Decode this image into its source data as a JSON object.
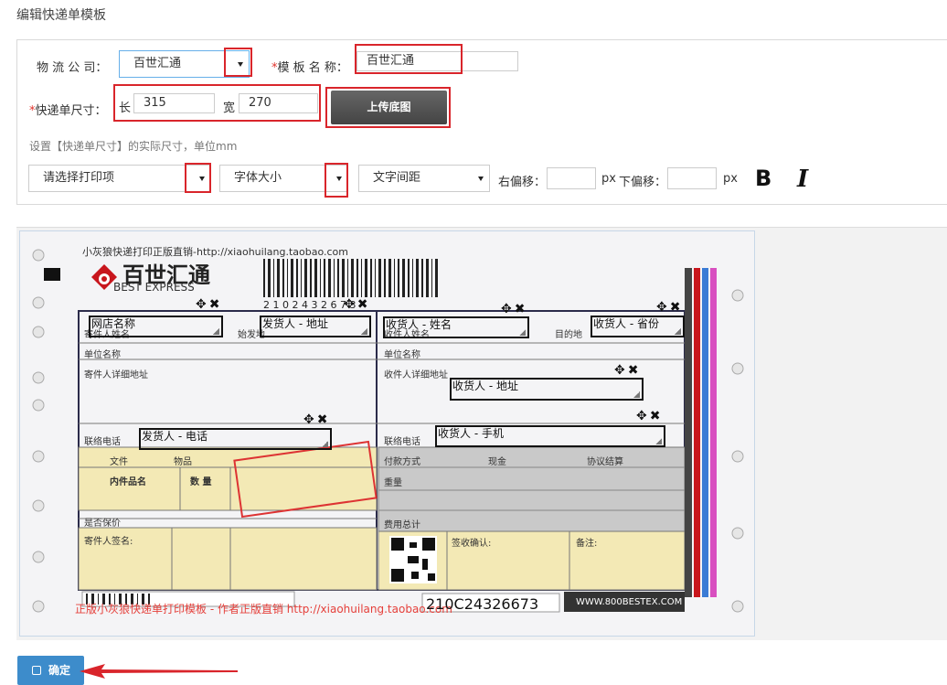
{
  "page_title": "编辑快递单模板",
  "company": {
    "label": "物 流 公 司：",
    "value": "百世汇通"
  },
  "template_name": {
    "required_mark": "*",
    "label": "模 板 名 称：",
    "value": "百世汇通"
  },
  "size": {
    "required_mark": "*",
    "label": "快递单尺寸：",
    "length_label": "长",
    "length_value": "315",
    "width_label": "宽",
    "width_value": "270"
  },
  "upload_button": "上传底图",
  "hint": "设置【快递单尺寸】的实际尺寸，单位mm",
  "print_item_select": "请选择打印项",
  "font_size_select": "字体大小",
  "spacing_select": "文字间距",
  "right_offset_label": "右偏移：",
  "down_offset_label": "下偏移：",
  "px_unit": "px",
  "bold_label": "B",
  "italic_label": "I",
  "waybill": {
    "top_url": "小灰狼快递打印正版直销-http://xiaohuilang.taobao.com",
    "brand_cn": "百世汇通",
    "brand_en": "BEST EXPRESS",
    "barcode_digits": "2 1 0 2 4 3 2 6 7 3",
    "bottom_number": "210C24326673",
    "website": "WWW.800BESTEX.COM",
    "watermark": "正版小灰狼快递单打印模板 - 作者正版直销 http://xiaohuilang.taobao.com",
    "labels": {
      "sender_name": "寄件人姓名",
      "origin": "始发地",
      "receiver_name": "收件人姓名",
      "destination": "目的地",
      "company_left": "单位名称",
      "company_right": "单位名称",
      "sender_address": "寄件人详细地址",
      "receiver_address": "收件人详细地址",
      "contact_left": "联络电话",
      "contact_right": "联络电话",
      "document": "文件",
      "goods": "物品",
      "item_name": "内件品名",
      "quantity": "数 量",
      "payment": "付款方式",
      "cash": "现金",
      "agreement": "协议结算",
      "weight": "重量",
      "fee_total": "费用总计",
      "insured": "是否保价",
      "sender_sign": "寄件人签名:",
      "receipt": "签收确认:",
      "remark": "备注:"
    },
    "fields": {
      "shop_name": "网店名称",
      "sender_address": "发货人 - 地址",
      "receiver_name": "收货人 - 姓名",
      "receiver_province": "收货人 - 省份",
      "receiver_address": "收货人 - 地址",
      "sender_phone": "发货人 - 电话",
      "receiver_mobile": "收货人 - 手机"
    }
  },
  "confirm_button": "确定",
  "colors": {
    "accent_red": "#d9252b",
    "confirm_blue": "#3d8ccb",
    "upload_dark": "#555555"
  }
}
